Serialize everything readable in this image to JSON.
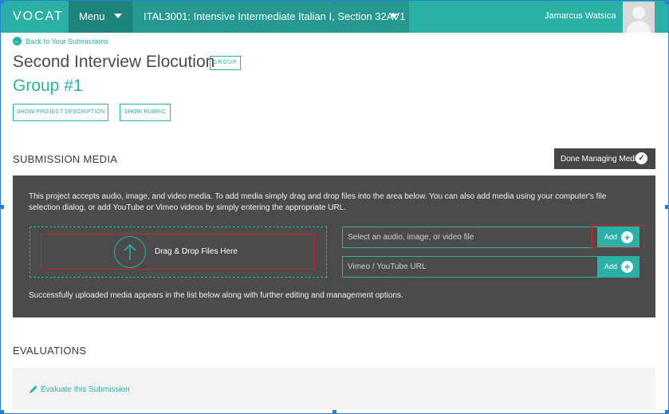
{
  "topbar": {
    "logo": "VOCAT",
    "menu_label": "Menu",
    "course_label": "ITAL3001: Intensive Intermediate Italian I, Section 32AV1",
    "user_name": "Jamarcus Watsica",
    "accent_color": "#2bb0a5"
  },
  "header": {
    "back_link": "Back to Your Submissions",
    "title": "Second Interview Elocution",
    "badge": "GROUP",
    "group_name": "Group #1",
    "show_project_description": "SHOW PROJECT DESCRIPTION",
    "show_rubric": "SHOW RUBRIC"
  },
  "submission_media": {
    "heading": "SUBMISSION MEDIA",
    "done_button": "Done Managing Media",
    "description": "This project accepts audio, image, and video media. To add media simply drag and drop files into the area below. You can also add media using your computer's file selection dialog, or add YouTube or Vimeo videos by simply entering the appropriate URL.",
    "drop_label": "Drag & Drop Files Here",
    "file_placeholder": "Select an audio, image, or video file",
    "url_placeholder": "Vimeo / YouTube URL",
    "add_label": "Add",
    "footer": "Successfully uploaded media appears in the list below along with further editing and management options."
  },
  "evaluations": {
    "heading": "EVALUATIONS",
    "link": "Evaluate this Submission"
  },
  "icons": {
    "back": "arrow-left-circle-icon",
    "caret": "chevron-down-icon",
    "check": "check-circle-icon",
    "upload": "upload-arrow-icon",
    "plus": "plus-circle-icon",
    "pencil": "pencil-icon",
    "avatar": "user-avatar-icon"
  }
}
